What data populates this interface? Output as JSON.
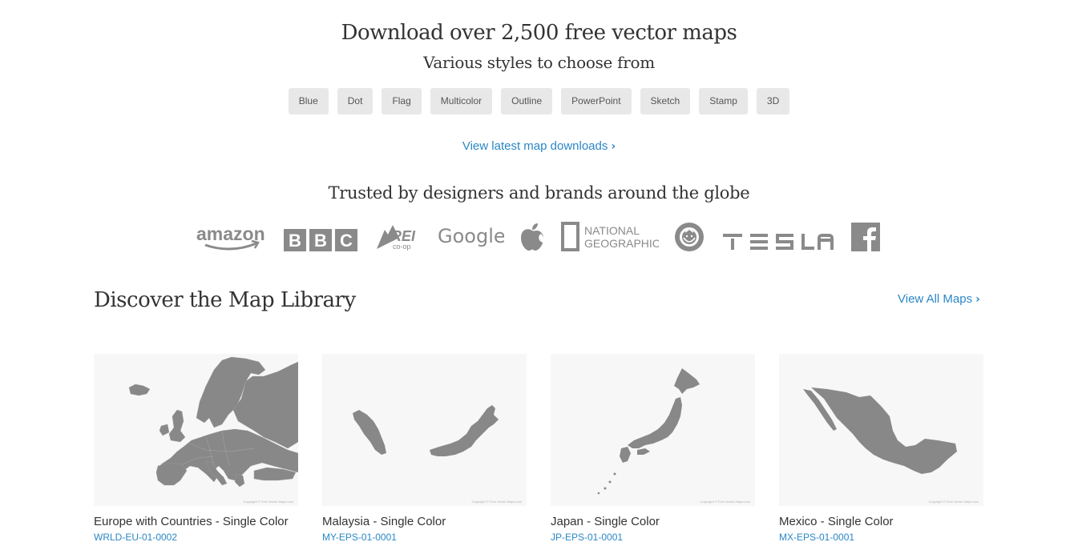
{
  "hero": {
    "title": "Download over 2,500 free vector maps",
    "subtitle": "Various styles to choose from"
  },
  "styles": [
    "Blue",
    "Dot",
    "Flag",
    "Multicolor",
    "Outline",
    "PowerPoint",
    "Sketch",
    "Stamp",
    "3D"
  ],
  "latest_link": {
    "label": "View latest map downloads"
  },
  "trusted": {
    "title": "Trusted by designers and brands around the globe",
    "brands": [
      {
        "name": "amazon",
        "icon": "amazon-logo",
        "text": "amazon"
      },
      {
        "name": "bbc",
        "icon": "bbc-logo",
        "text": "BBC"
      },
      {
        "name": "rei",
        "icon": "rei-coop-logo",
        "text": "REI co-op"
      },
      {
        "name": "google",
        "icon": "google-logo",
        "text": "Google"
      },
      {
        "name": "apple",
        "icon": "apple-logo",
        "text": ""
      },
      {
        "name": "national-geographic",
        "icon": "national-geographic-logo",
        "text": "NATIONAL GEOGRAPHIC"
      },
      {
        "name": "starbucks",
        "icon": "starbucks-logo",
        "text": ""
      },
      {
        "name": "tesla",
        "icon": "tesla-logo",
        "text": "TESLA"
      },
      {
        "name": "facebook",
        "icon": "facebook-logo",
        "text": "f"
      }
    ],
    "logo_color": "#8a8a8a"
  },
  "library": {
    "title": "Discover the Map Library",
    "view_all": "View All Maps",
    "maps": [
      {
        "title": "Europe with Countries - Single Color",
        "code": "WRLD-EU-01-0002",
        "icon": "europe-map"
      },
      {
        "title": "Malaysia - Single Color",
        "code": "MY-EPS-01-0001",
        "icon": "malaysia-map"
      },
      {
        "title": "Japan - Single Color",
        "code": "JP-EPS-01-0001",
        "icon": "japan-map"
      },
      {
        "title": "Mexico - Single Color",
        "code": "MX-EPS-01-0001",
        "icon": "mexico-map"
      }
    ]
  },
  "colors": {
    "link": "#2b87c6",
    "button_bg": "#e8e8e8",
    "map_fill": "#888888",
    "thumb_bg": "#f7f7f7"
  }
}
